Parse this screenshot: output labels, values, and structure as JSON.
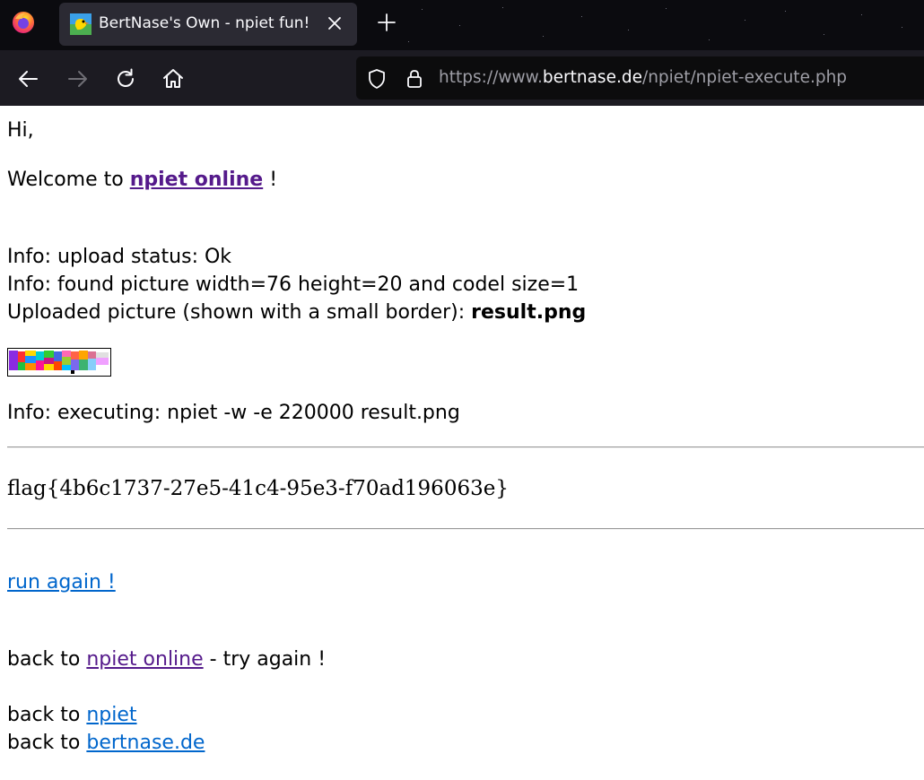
{
  "browser": {
    "tab_title": "BertNase's Own - npiet fun!",
    "url_prefix": "https://www.",
    "url_domain": "bertnase.de",
    "url_path": "/npiet/npiet-execute.php",
    "icons": {
      "firefox": "firefox-logo-icon",
      "favicon": "npiet-favicon-icon",
      "close": "close-icon",
      "new_tab": "plus-icon",
      "back": "arrow-left-icon",
      "forward": "arrow-right-icon",
      "reload": "reload-icon",
      "home": "home-icon",
      "shield": "shield-icon",
      "lock": "lock-icon"
    }
  },
  "page": {
    "greeting": "Hi,",
    "welcome_prefix": "Welcome to ",
    "welcome_link": "npiet online",
    "welcome_suffix": " !",
    "info_upload": "Info: upload status: Ok",
    "info_found": "Info: found picture width=76 height=20 and codel size=1",
    "uploaded_prefix": "Uploaded picture (shown with a small border): ",
    "uploaded_file": "result.png",
    "info_exec": "Info: executing: npiet -w -e 220000 result.png",
    "flag": "flag{4b6c1737-27e5-41c4-95e3-f70ad196063e}",
    "run_again": "run again !",
    "back1_prefix": "back to ",
    "back1_link": "npiet online",
    "back1_suffix": " - try again !",
    "back2_prefix": "back to ",
    "back2_link": "npiet",
    "back3_prefix": "back to ",
    "back3_link": "bertnase.de"
  },
  "colors": {
    "link": "#0066cc",
    "visited_link": "#551a8b",
    "tabbar_bg": "#0b0b0f",
    "navbar_bg": "#1c1b22",
    "tab_bg": "#2b2a33"
  }
}
